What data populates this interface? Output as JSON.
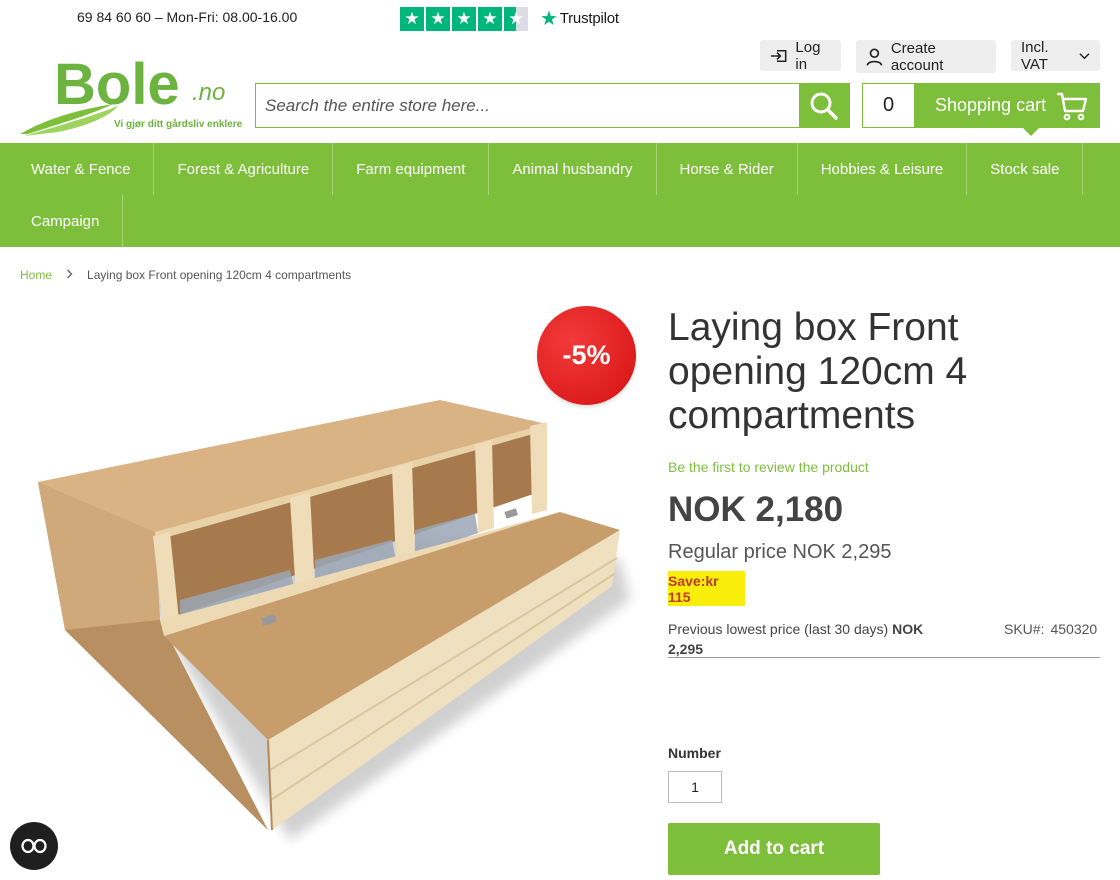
{
  "topbar": {
    "phone": "69 84 60 60 – Mon-Fri: 08.00-16.00",
    "trustpilot": {
      "brand": "Trustpilot",
      "rating_stars": 4.5,
      "color": "#00b67a"
    }
  },
  "account": {
    "login_label": "Log in",
    "create_label": "Create account",
    "vat_label": "Incl. VAT"
  },
  "logo": {
    "name": "Bole",
    "suffix": ".no",
    "tagline": "Vi gjør ditt gårdsliv enklere"
  },
  "search": {
    "placeholder": "Search the entire store here..."
  },
  "cart": {
    "count": "0",
    "label": "Shopping cart"
  },
  "nav": {
    "items": [
      "Water & Fence",
      "Forest & Agriculture",
      "Farm equipment",
      "Animal husbandry",
      "Horse & Rider",
      "Hobbies & Leisure",
      "Stock sale",
      "Campaign"
    ]
  },
  "breadcrumb": {
    "home": "Home",
    "current": "Laying box Front opening 120cm 4 compartments"
  },
  "product": {
    "discount_badge": "-5%",
    "title": "Laying box Front opening 120cm 4 compartments",
    "review_link": "Be the first to review the product",
    "price": "NOK 2,180",
    "regular_label": "Regular price",
    "regular_price": "NOK 2,295",
    "save": "Save:kr 115",
    "prev_low_label": "Previous lowest price (last 30 days)",
    "prev_low_value": "NOK 2,295",
    "sku_label": "SKU#:",
    "sku_value": "450320",
    "qty_label": "Number",
    "qty_value": "1",
    "add_to_cart": "Add to cart"
  },
  "colors": {
    "brand_green": "#7dbf3b",
    "badge_red": "#e21b1b",
    "save_yellow": "#f8ee0a"
  }
}
